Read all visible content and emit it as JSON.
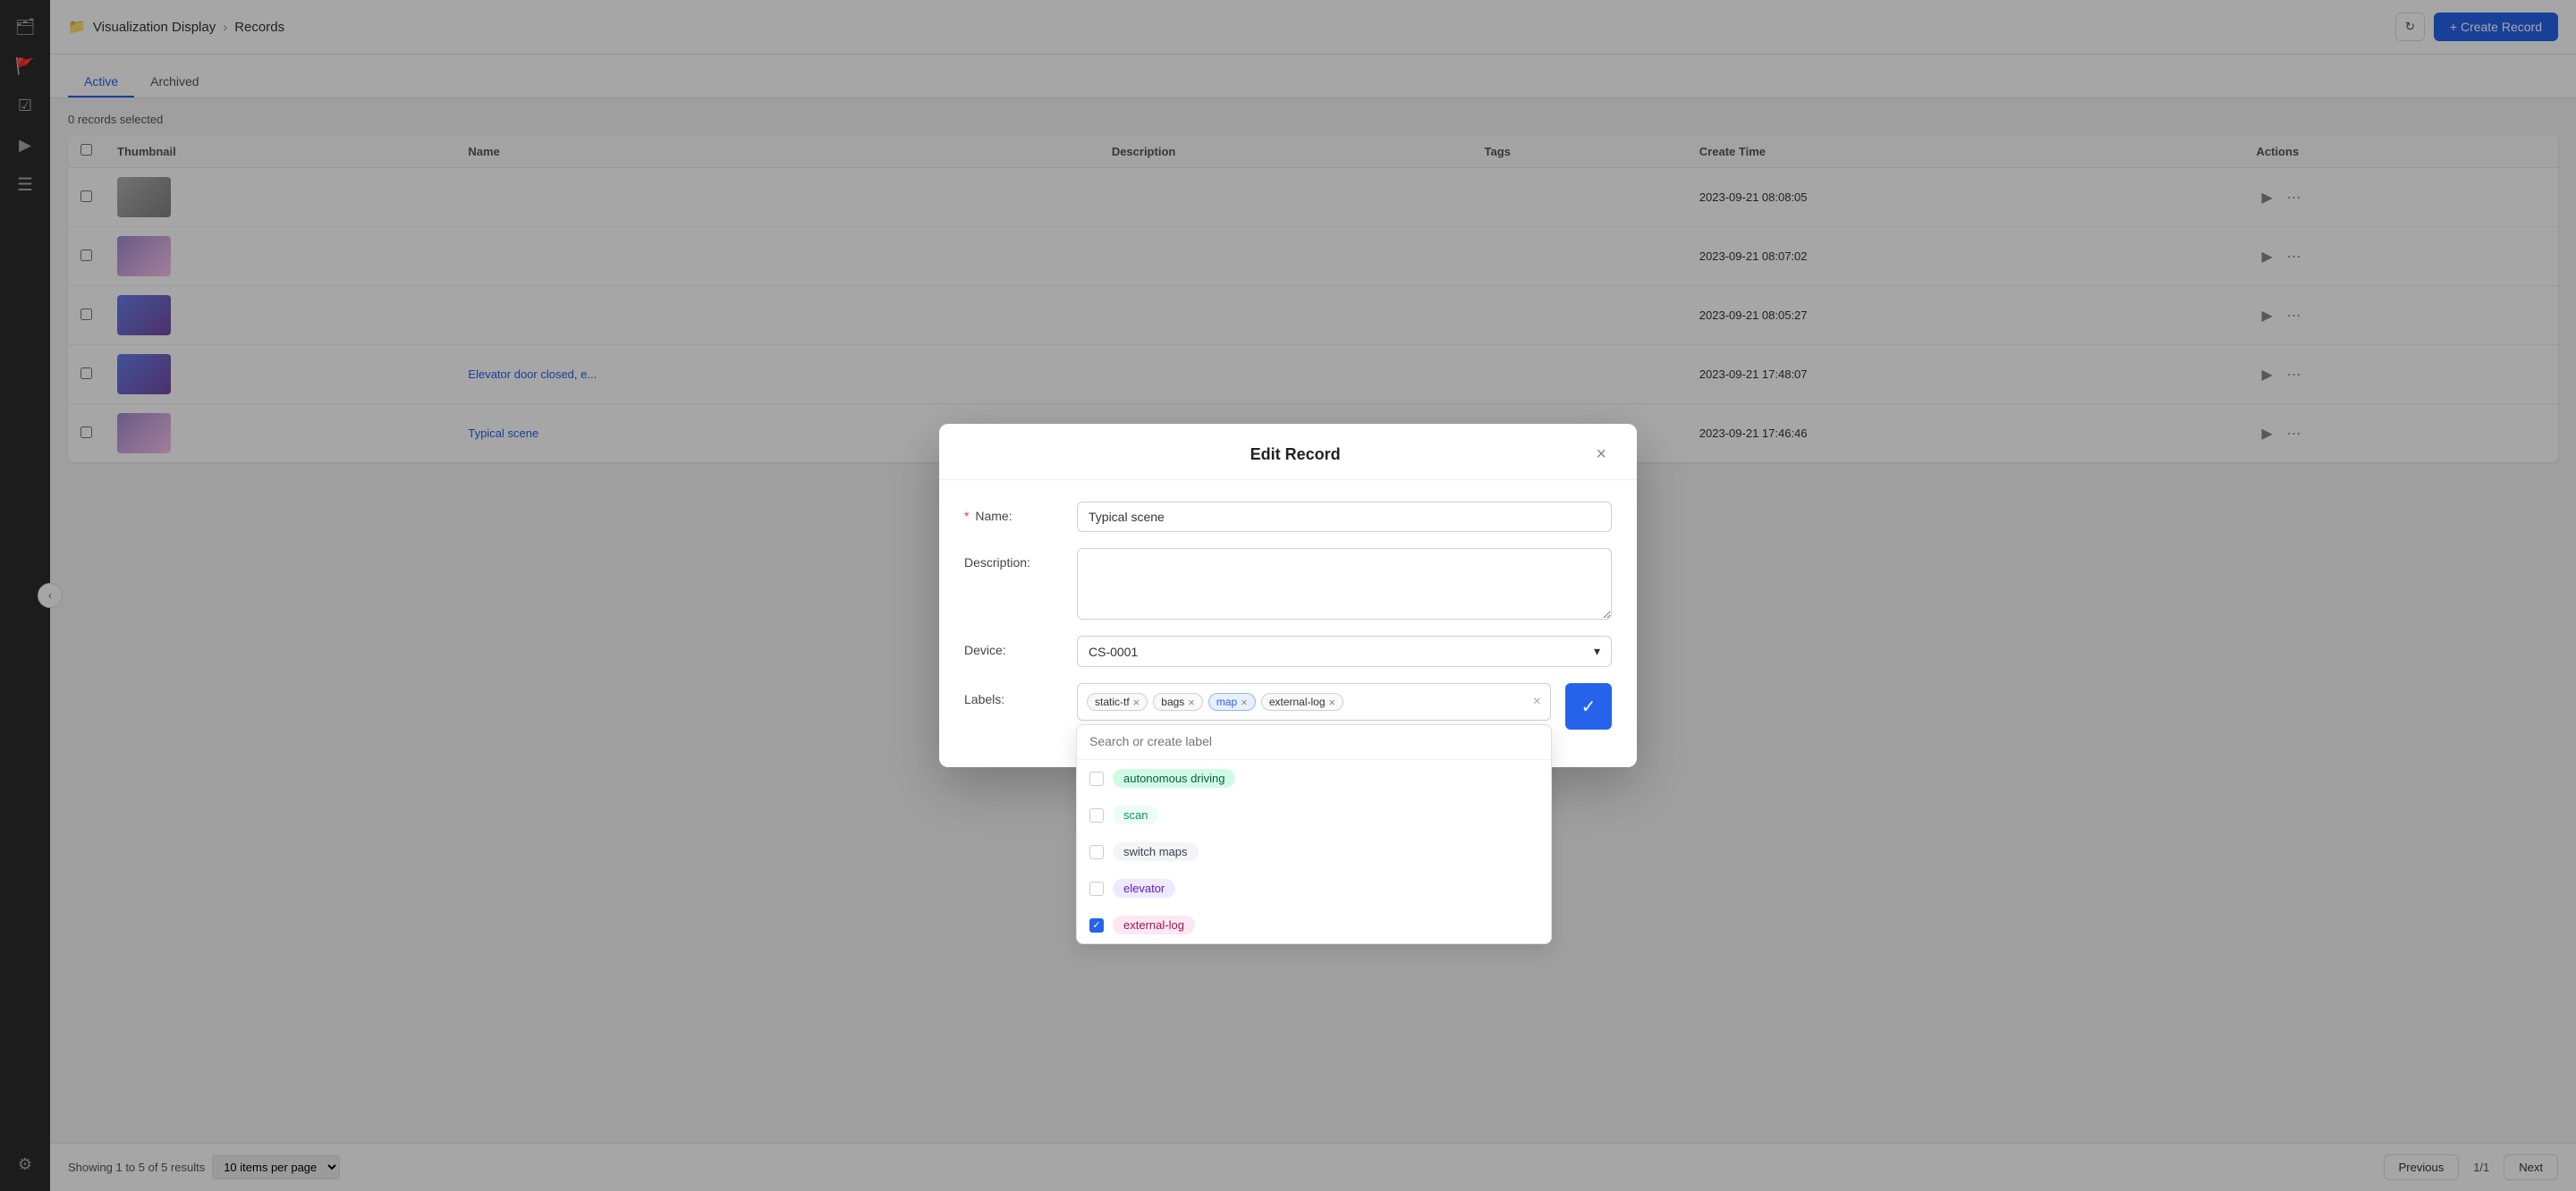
{
  "sidebar": {
    "icons": [
      {
        "name": "folder-icon",
        "symbol": "🗂",
        "interactable": true
      },
      {
        "name": "flag-icon",
        "symbol": "🚩",
        "interactable": true
      },
      {
        "name": "check-icon",
        "symbol": "☑",
        "interactable": true
      },
      {
        "name": "play-icon",
        "symbol": "▶",
        "interactable": true
      },
      {
        "name": "layers-icon",
        "symbol": "≡",
        "interactable": true
      },
      {
        "name": "settings-icon",
        "symbol": "⚙",
        "interactable": true
      }
    ]
  },
  "header": {
    "breadcrumb_root": "Visualization Display",
    "breadcrumb_current": "Records",
    "refresh_label": "↻",
    "create_button_label": "+ Create Record"
  },
  "tabs": [
    {
      "id": "active",
      "label": "Active",
      "active": true
    },
    {
      "id": "archived",
      "label": "Archived",
      "active": false
    }
  ],
  "table": {
    "meta": "0 records selected",
    "columns": [
      "",
      "Thumbnail",
      "Name",
      "Description",
      "Tags",
      "Create Time",
      "Actions"
    ],
    "rows": [
      {
        "id": "row-1",
        "thumb_type": "gray",
        "name": "",
        "description": "",
        "tags": "",
        "create_time": "2023-09-21 08:08:05"
      },
      {
        "id": "row-2",
        "thumb_type": "purple",
        "name": "",
        "description": "",
        "tags": "",
        "create_time": "2023-09-21 08:07:02"
      },
      {
        "id": "row-3",
        "thumb_type": "blue",
        "name": "",
        "description": "",
        "tags": "",
        "create_time": "2023-09-21 08:05:27"
      },
      {
        "id": "row-4",
        "thumb_type": "blue",
        "name": "Elevator door closed, e...",
        "name_link": true,
        "description": "",
        "tags": "",
        "create_time": "2023-09-21 17:48:07"
      },
      {
        "id": "row-5",
        "thumb_type": "purple",
        "name": "Typical scene",
        "name_link": true,
        "description": "",
        "tags": "",
        "create_time": "2023-09-21 17:46:46"
      }
    ]
  },
  "pagination": {
    "showing_text": "Showing 1 to 5 of 5 results",
    "per_page_label": "10 items per pa...",
    "page_indicator": "1/1",
    "previous_label": "Previous",
    "next_label": "Next"
  },
  "modal": {
    "title": "Edit Record",
    "close_label": "×",
    "fields": {
      "name_label": "Name:",
      "name_required": true,
      "name_value": "Typical scene",
      "description_label": "Description:",
      "description_value": "",
      "device_label": "Device:",
      "device_value": "CS-0001",
      "labels_label": "Labels:"
    },
    "selected_labels": [
      {
        "id": "static-tf",
        "text": "static-tf",
        "highlighted": false
      },
      {
        "id": "bags",
        "text": "bags",
        "highlighted": false
      },
      {
        "id": "map",
        "text": "map",
        "highlighted": true
      },
      {
        "id": "external-log",
        "text": "external-log",
        "highlighted": false
      }
    ],
    "label_search_placeholder": "Search or create label",
    "label_options": [
      {
        "id": "autonomous-driving",
        "text": "autonomous driving",
        "badge_class": "green",
        "checked": false
      },
      {
        "id": "scan",
        "text": "scan",
        "badge_class": "light-green",
        "checked": false
      },
      {
        "id": "switch-maps",
        "text": "switch maps",
        "badge_class": "neutral",
        "checked": false
      },
      {
        "id": "elevator",
        "text": "elevator",
        "badge_class": "purple",
        "checked": false
      },
      {
        "id": "external-log-opt",
        "text": "external-log",
        "badge_class": "pink",
        "checked": true
      }
    ]
  }
}
